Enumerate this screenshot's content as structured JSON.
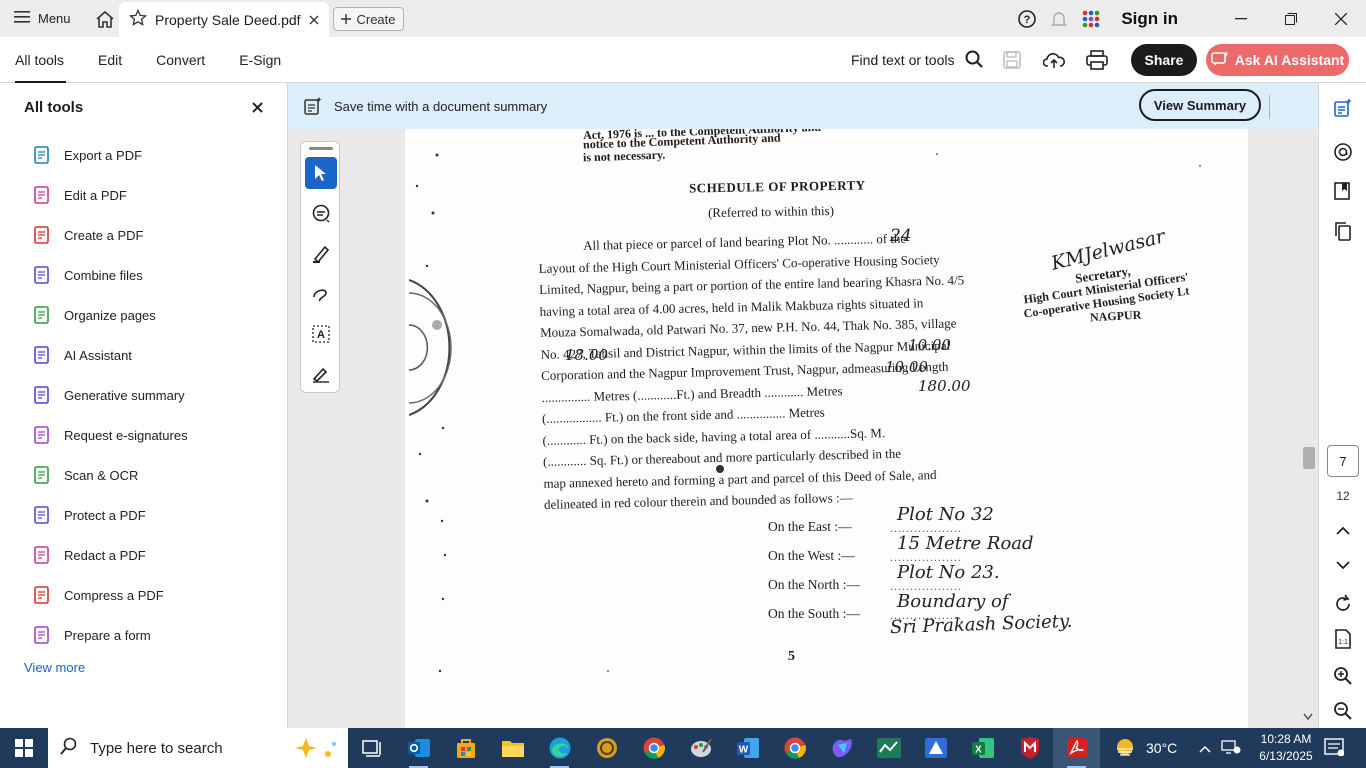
{
  "titlebar": {
    "menu_label": "Menu",
    "tab_title": "Property Sale Deed.pdf",
    "create_label": "Create",
    "sign_in": "Sign in"
  },
  "toolbar": {
    "nav": [
      "All tools",
      "Edit",
      "Convert",
      "E-Sign"
    ],
    "find_placeholder": "Find text or tools",
    "share_label": "Share",
    "ai_label": "Ask AI Assistant"
  },
  "left_panel": {
    "title": "All tools",
    "items": [
      {
        "label": "Export a PDF",
        "icon": "export-pdf-icon",
        "color": "#1c7fb5"
      },
      {
        "label": "Edit a PDF",
        "icon": "edit-pdf-icon",
        "color": "#c2399a"
      },
      {
        "label": "Create a PDF",
        "icon": "create-pdf-icon",
        "color": "#d6302a"
      },
      {
        "label": "Combine files",
        "icon": "combine-files-icon",
        "color": "#4a4fd1"
      },
      {
        "label": "Organize pages",
        "icon": "organize-pages-icon",
        "color": "#2e9a3a"
      },
      {
        "label": "AI Assistant",
        "icon": "ai-assistant-icon",
        "color": "#5a3fd6"
      },
      {
        "label": "Generative summary",
        "icon": "generative-summary-icon",
        "color": "#5a3fd6"
      },
      {
        "label": "Request e-signatures",
        "icon": "request-esign-icon",
        "color": "#a23fc2"
      },
      {
        "label": "Scan & OCR",
        "icon": "scan-ocr-icon",
        "color": "#2e9a3a"
      },
      {
        "label": "Protect a PDF",
        "icon": "protect-pdf-icon",
        "color": "#4a4fd1"
      },
      {
        "label": "Redact a PDF",
        "icon": "redact-pdf-icon",
        "color": "#c2399a"
      },
      {
        "label": "Compress a PDF",
        "icon": "compress-pdf-icon",
        "color": "#d6302a"
      },
      {
        "label": "Prepare a form",
        "icon": "prepare-form-icon",
        "color": "#a23fc2"
      }
    ],
    "view_more": "View more"
  },
  "banner": {
    "text": "Save time with a document summary",
    "button": "View Summary"
  },
  "document": {
    "top_lines": [
      "Act, 1976 is ... to the Competent Authority and",
      "notice to the Competent Authority and",
      "is not necessary."
    ],
    "heading": "SCHEDULE OF PROPERTY",
    "subheading": "(Referred to within this)",
    "para_lines": [
      "All that piece or parcel of land bearing Plot No. ............ of the",
      "Layout of the High Court Ministerial Officers' Co-operative Housing Society",
      "Limited, Nagpur, being a part or portion of the entire land bearing Khasra No. 4/5",
      "having a total area of 4.00 acres, held in Malik Makbuza rights situated in",
      "Mouza Somalwada, old Patwari No. 37, new P.H. No. 44, Thak No. 385, village",
      "No. 427, Tahsil and District Nagpur, within the limits of the Nagpur Municipal",
      "Corporation and the Nagpur Improvement Trust, Nagpur, admeasuring Length",
      "............... Metres (............Ft.) and Breadth ............ Metres",
      "(................. Ft.) on the front side and ............... Metres",
      "(............ Ft.) on the back side, having a total area of ...........Sq. M.",
      "(............ Sq. Ft.) or thereabout and more particularly described in the",
      "map annexed hereto and forming a part and parcel of this Deed of Sale, and",
      "delineated in red colour therein and bounded as follows :—"
    ],
    "handwritten": {
      "plot_no": "24",
      "length": "18.00",
      "breadth": "10.00",
      "back": "10.00",
      "area": "180.00",
      "signature": "KMJelwasar"
    },
    "stamp_lines": [
      "Secretary,",
      "High Court Ministerial Officers'",
      "Co-operative Housing Society Lt",
      "NAGPUR"
    ],
    "bounds": [
      {
        "label": "On the East :—",
        "value": "Plot No 32"
      },
      {
        "label": "On the West :—",
        "value": "15 Metre Road"
      },
      {
        "label": "On the North :—",
        "value": "Plot No 23."
      },
      {
        "label": "On the South :—",
        "value": "Boundary of"
      }
    ],
    "south_extra": "Sri Prakash Society.",
    "page_number": "5"
  },
  "page_nav": {
    "current": "7",
    "total": "12"
  },
  "taskbar": {
    "search_placeholder": "Type here to search",
    "temperature": "30°C",
    "time": "10:28 AM",
    "date": "6/13/2025"
  }
}
